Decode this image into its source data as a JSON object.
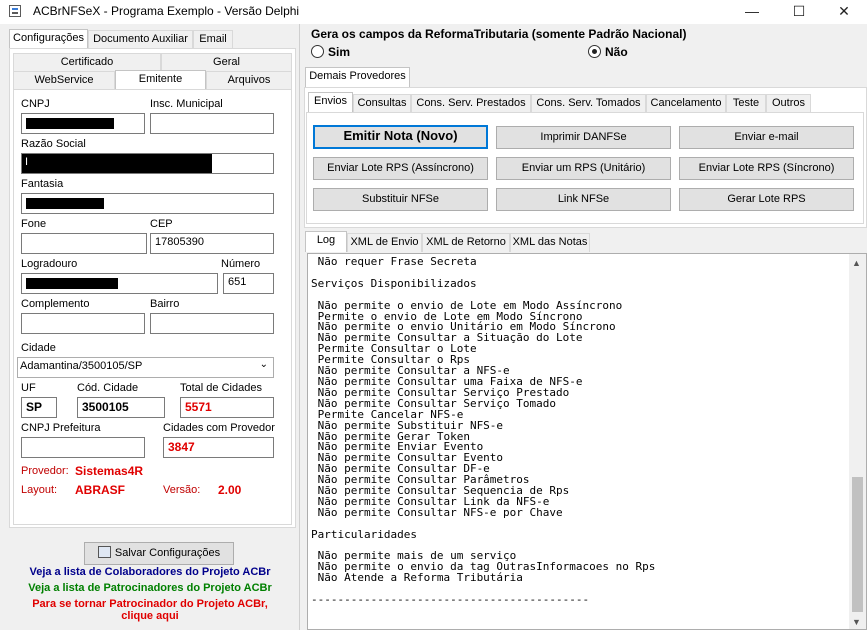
{
  "window": {
    "title": "ACBrNFSeX - Programa Exemplo - Versão Delphi",
    "minimize": "—",
    "maximize": "☐",
    "close": "✕"
  },
  "left_tabs": [
    "Configurações",
    "Documento Auxiliar",
    "Email"
  ],
  "config_tabs_row1": [
    "Certificado",
    "Geral"
  ],
  "config_tabs_row2": [
    "WebService",
    "Emitente",
    "Arquivos"
  ],
  "emitente": {
    "cnpj_label": "CNPJ",
    "insc_label": "Insc. Municipal",
    "razao_label": "Razão Social",
    "razao_value": "I",
    "fantasia_label": "Fantasia",
    "fone_label": "Fone",
    "cep_label": "CEP",
    "cep_value": "17805390",
    "logradouro_label": "Logradouro",
    "numero_label": "Número",
    "numero_value": "651",
    "complemento_label": "Complemento",
    "bairro_label": "Bairro",
    "cidade_label": "Cidade",
    "cidade_value": "Adamantina/3500105/SP",
    "uf_label": "UF",
    "uf_value": "SP",
    "cod_cidade_label": "Cód. Cidade",
    "cod_cidade_value": "3500105",
    "total_cidades_label": "Total de Cidades",
    "total_cidades_value": "5571",
    "cnpj_prefeitura_label": "CNPJ Prefeitura",
    "cidades_provedor_label": "Cidades com Provedor",
    "cidades_provedor_value": "3847",
    "provedor_label": "Provedor:",
    "provedor_value": "Sistemas4R",
    "layout_label": "Layout:",
    "layout_value": "ABRASF",
    "versao_label": "Versão:",
    "versao_value": "2.00"
  },
  "save_button": "Salvar Configurações",
  "links": {
    "colaboradores": "Veja a lista de Colaboradores do Projeto ACBr",
    "patrocinadores": "Veja a lista de Patrocinadores do Projeto ACBr",
    "tornar_1": "Para se tornar Patrocinador do Projeto ACBr,",
    "tornar_2": "clique aqui"
  },
  "reforma": {
    "title": "Gera os campos da ReformaTributaria (somente Padrão Nacional)",
    "sim": "Sim",
    "nao": "Não",
    "selected": "Não"
  },
  "provider_tab": "Demais Provedores",
  "action_tabs": [
    "Envios",
    "Consultas",
    "Cons. Serv. Prestados",
    "Cons. Serv. Tomados",
    "Cancelamento",
    "Teste",
    "Outros"
  ],
  "buttons": {
    "emitir": "Emitir Nota (Novo)",
    "imprimir": "Imprimir DANFSe",
    "email": "Enviar e-mail",
    "lote_assinc": "Enviar Lote RPS (Assíncrono)",
    "rps_unitario": "Enviar um RPS (Unitário)",
    "lote_sinc": "Enviar Lote RPS (Síncrono)",
    "substituir": "Substituir NFSe",
    "link": "Link NFSe",
    "gerar_lote": "Gerar Lote RPS"
  },
  "log_tabs": [
    "Log",
    "XML de Envio",
    "XML de Retorno",
    "XML das Notas"
  ],
  "log_lines": [
    " Não requer Frase Secreta",
    "",
    "Serviços Disponibilizados",
    "",
    " Não permite o envio de Lote em Modo Assíncrono",
    " Permite o envio de Lote em Modo Síncrono",
    " Não permite o envio Unitário em Modo Síncrono",
    " Não permite Consultar a Situação do Lote",
    " Permite Consultar o Lote",
    " Permite Consultar o Rps",
    " Não permite Consultar a NFS-e",
    " Não permite Consultar uma Faixa de NFS-e",
    " Não permite Consultar Serviço Prestado",
    " Não permite Consultar Serviço Tomado",
    " Permite Cancelar NFS-e",
    " Não permite Substituir NFS-e",
    " Não permite Gerar Token",
    " Não permite Enviar Evento",
    " Não permite Consultar Evento",
    " Não permite Consultar DF-e",
    " Não permite Consultar Parâmetros",
    " Não permite Consultar Sequencia de Rps",
    " Não permite Consultar Link da NFS-e",
    " Não permite Consultar NFS-e por Chave",
    "",
    "Particularidades",
    "",
    " Não permite mais de um serviço",
    " Não permite o envio da tag OutrasInformacoes no Rps",
    " Não Atende a Reforma Tributária",
    "",
    "------------------------------------------"
  ],
  "icons": {
    "save": "save-icon",
    "app": "app-icon",
    "dropdown": "chevron-down-icon",
    "scroll_up": "scroll-up-icon",
    "scroll_down": "scroll-down-icon"
  }
}
